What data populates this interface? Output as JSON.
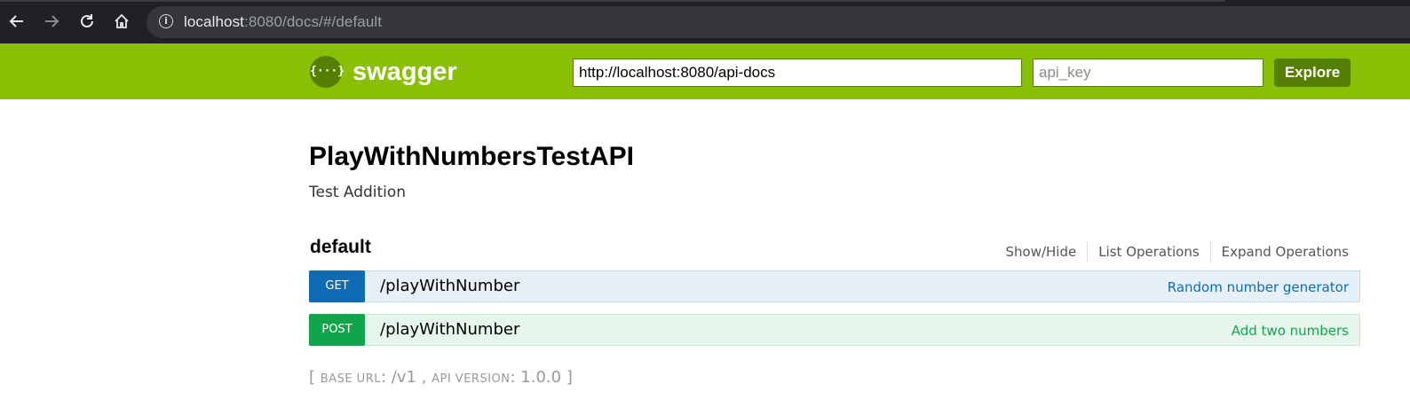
{
  "browser": {
    "url_host": "localhost",
    "url_rest": ":8080/docs/#/default",
    "colors": {
      "chrome_bg": "#202124",
      "omnibox_bg": "#35363a"
    }
  },
  "header": {
    "logo_text": "swagger",
    "logo_glyph": "{···}",
    "api_url": "http://localhost:8080/api-docs",
    "api_key_placeholder": "api_key",
    "explore_label": "Explore",
    "colors": {
      "bar": "#89bf04",
      "dark": "#547f00"
    }
  },
  "info": {
    "title": "PlayWithNumbersTestAPI",
    "description": "Test Addition"
  },
  "resource": {
    "name": "default",
    "options": [
      "Show/Hide",
      "List Operations",
      "Expand Operations"
    ],
    "operations": [
      {
        "method": "GET",
        "path": "/playWithNumber",
        "summary": "Random number generator",
        "color": "#0f6ab4"
      },
      {
        "method": "POST",
        "path": "/playWithNumber",
        "summary": "Add two numbers",
        "color": "#10a54a"
      }
    ]
  },
  "footer": {
    "open_bracket": "[",
    "base_url_label": "base url",
    "base_url_value": "/v1",
    "api_version_label": "api version",
    "api_version_value": "1.0.0",
    "close_bracket": "]"
  }
}
